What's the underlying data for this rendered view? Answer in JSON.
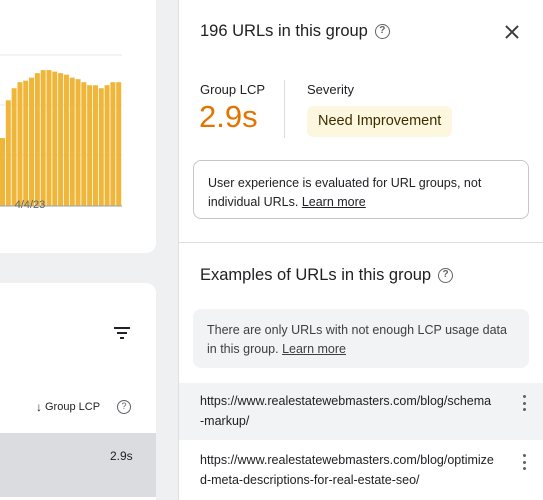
{
  "background": {
    "chart": {
      "date_label": "4/4/23",
      "bar_color": "#f0b63a",
      "bars": [
        0.45,
        0.7,
        0.78,
        0.82,
        0.83,
        0.85,
        0.88,
        0.9,
        0.9,
        0.89,
        0.88,
        0.87,
        0.85,
        0.84,
        0.82,
        0.8,
        0.8,
        0.78,
        0.8,
        0.82,
        0.82
      ]
    },
    "table": {
      "sort_label": "Group LCP",
      "row_value": "2.9s"
    }
  },
  "panel": {
    "title": "196 URLs in this group",
    "group_lcp_label": "Group LCP",
    "group_lcp_value": "2.9s",
    "severity_label": "Severity",
    "severity_value": "Need Improvement",
    "info_text": "User experience is evaluated for URL groups, not individual URLs.",
    "info_link": "Learn more",
    "examples_title": "Examples of URLs in this group",
    "notice_text": "There are only URLs with not enough LCP usage data in this group.",
    "notice_link": "Learn more",
    "urls": [
      "https://www.realestatewebmasters.com/blog/schema-markup/",
      "https://www.realestatewebmasters.com/blog/optimized-meta-descriptions-for-real-estate-seo/"
    ]
  },
  "colors": {
    "lcp_value": "#e37400",
    "severity_bg": "#fef7e0"
  }
}
